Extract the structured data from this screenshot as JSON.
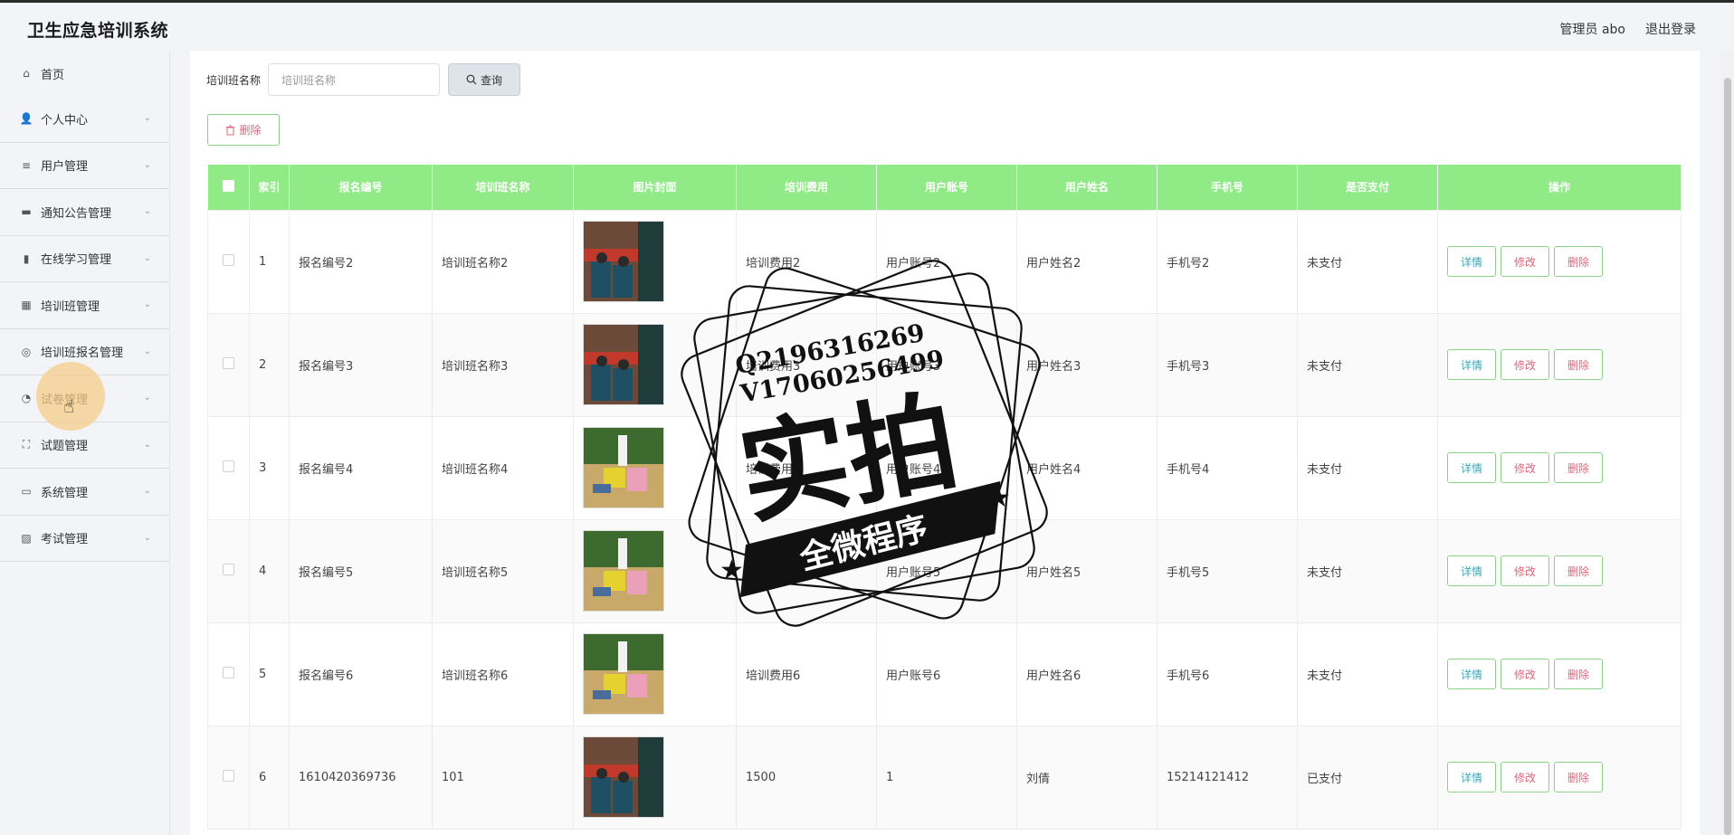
{
  "header": {
    "brand": "卫生应急培训系统",
    "user": "管理员 abo",
    "logout": "退出登录"
  },
  "sidebar": {
    "items": [
      {
        "label": "首页",
        "icon": "home-icon",
        "chevron": false
      },
      {
        "label": "个人中心",
        "icon": "person-icon",
        "chevron": true
      },
      {
        "label": "用户管理",
        "icon": "sliders-icon",
        "chevron": true
      },
      {
        "label": "通知公告管理",
        "icon": "briefcase-icon",
        "chevron": true
      },
      {
        "label": "在线学习管理",
        "icon": "book-icon",
        "chevron": true
      },
      {
        "label": "培训班管理",
        "icon": "grid-icon",
        "chevron": true
      },
      {
        "label": "培训班报名管理",
        "icon": "compass-icon",
        "chevron": true
      },
      {
        "label": "试卷管理",
        "icon": "gauge-icon",
        "chevron": true
      },
      {
        "label": "试题管理",
        "icon": "frame-icon",
        "chevron": true
      },
      {
        "label": "系统管理",
        "icon": "message-icon",
        "chevron": true
      },
      {
        "label": "考试管理",
        "icon": "chart-icon",
        "chevron": true
      }
    ]
  },
  "search": {
    "label": "培训班名称",
    "placeholder": "培训班名称",
    "query_label": "查询"
  },
  "toolbar": {
    "delete_label": "删除"
  },
  "table": {
    "columns": [
      "索引",
      "报名编号",
      "培训班名称",
      "图片封面",
      "培训费用",
      "用户账号",
      "用户姓名",
      "手机号",
      "是否支付",
      "操作"
    ],
    "rows": [
      {
        "index": "1",
        "number": "报名编号2",
        "class_name": "培训班名称2",
        "image": "classroom",
        "fee": "培训费用2",
        "account": "用户账号2",
        "name": "用户姓名2",
        "phone": "手机号2",
        "paid": "未支付"
      },
      {
        "index": "2",
        "number": "报名编号3",
        "class_name": "培训班名称3",
        "image": "classroom",
        "fee": "培训费用3",
        "account": "用户账号3",
        "name": "用户姓名3",
        "phone": "手机号3",
        "paid": "未支付"
      },
      {
        "index": "3",
        "number": "报名编号4",
        "class_name": "培训班名称4",
        "image": "outdoor",
        "fee": "培训费用4",
        "account": "用户账号4",
        "name": "用户姓名4",
        "phone": "手机号4",
        "paid": "未支付"
      },
      {
        "index": "4",
        "number": "报名编号5",
        "class_name": "培训班名称5",
        "image": "outdoor",
        "fee": "培训费用5",
        "account": "用户账号5",
        "name": "用户姓名5",
        "phone": "手机号5",
        "paid": "未支付"
      },
      {
        "index": "5",
        "number": "报名编号6",
        "class_name": "培训班名称6",
        "image": "outdoor",
        "fee": "培训费用6",
        "account": "用户账号6",
        "name": "用户姓名6",
        "phone": "手机号6",
        "paid": "未支付"
      },
      {
        "index": "6",
        "number": "1610420369736",
        "class_name": "101",
        "image": "classroom",
        "fee": "1500",
        "account": "1",
        "name": "刘倩",
        "phone": "15214121412",
        "paid": "已支付"
      }
    ],
    "actions": {
      "detail": "详情",
      "edit": "修改",
      "delete": "删除"
    }
  },
  "watermark": {
    "line1": "Q2196316269",
    "line2": "V17060256499",
    "main": "实拍",
    "banner": "全微程序"
  },
  "colors": {
    "header_green": "#90ea86",
    "detail_text": "#3aa7b9",
    "danger_text": "#e2647a",
    "button_border": "#8ecf8a"
  }
}
